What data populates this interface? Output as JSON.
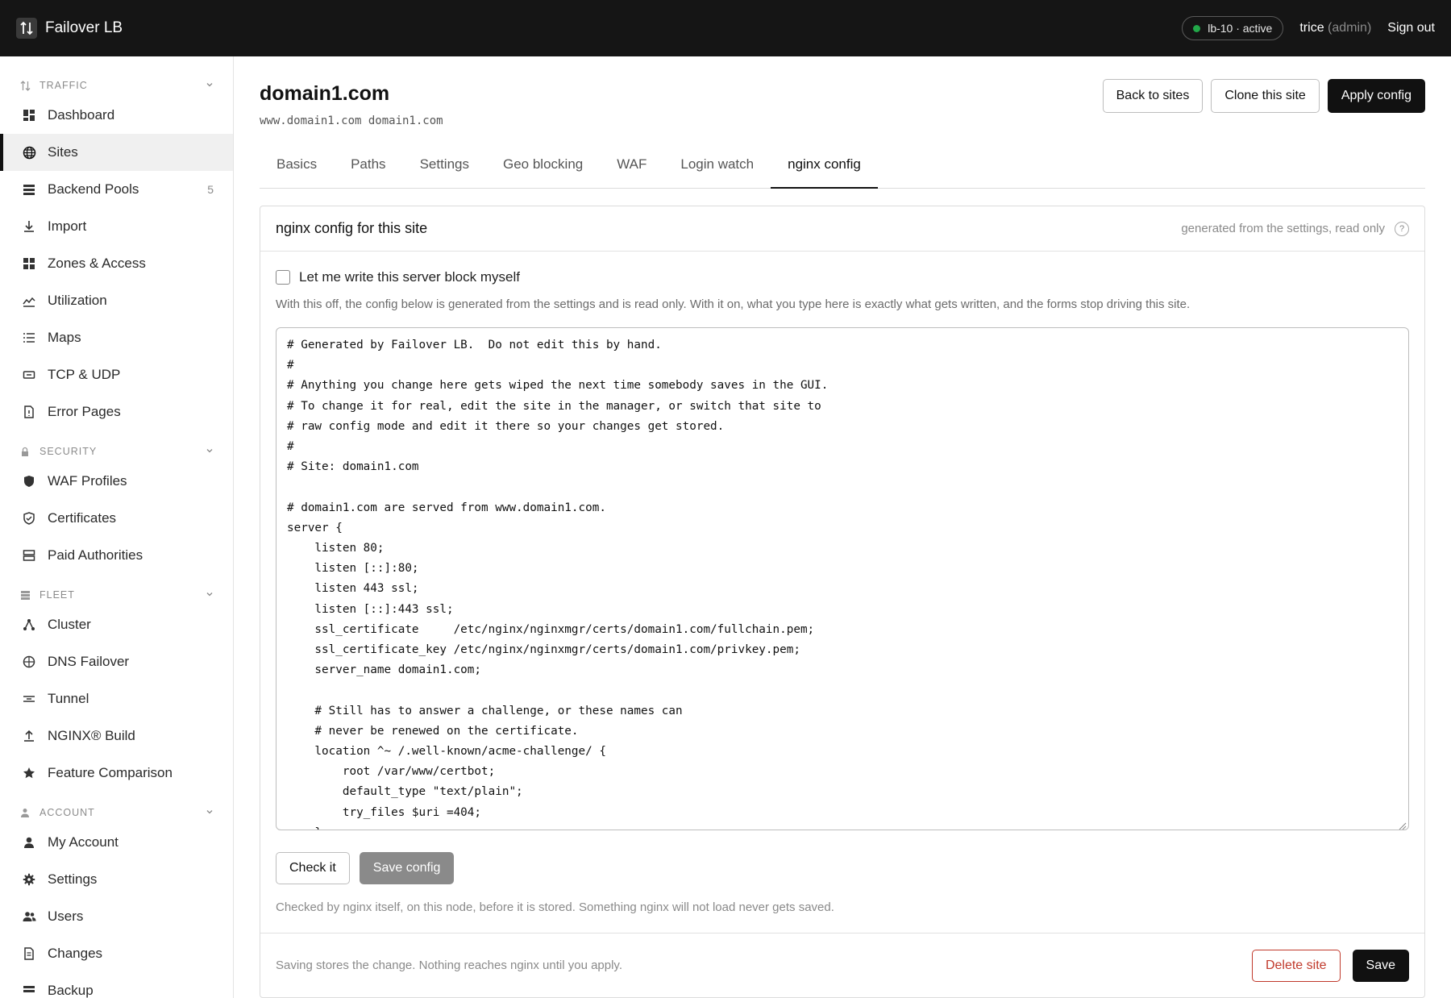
{
  "app": {
    "title": "Failover LB",
    "status": "lb-10 · active",
    "status_color": "#22a849",
    "user_name": "trice",
    "user_role": "(admin)",
    "sign_out": "Sign out"
  },
  "sidebar": {
    "sections": [
      {
        "title": "TRAFFIC",
        "icon": "arrows-updown-icon",
        "items": [
          {
            "label": "Dashboard",
            "icon": "dashboard-icon"
          },
          {
            "label": "Sites",
            "icon": "globe-icon",
            "active": true
          },
          {
            "label": "Backend Pools",
            "icon": "pools-icon",
            "count": "5"
          },
          {
            "label": "Import",
            "icon": "import-icon"
          },
          {
            "label": "Zones & Access",
            "icon": "zones-icon"
          },
          {
            "label": "Utilization",
            "icon": "chart-icon"
          },
          {
            "label": "Maps",
            "icon": "list-icon"
          },
          {
            "label": "TCP & UDP",
            "icon": "tcp-icon"
          },
          {
            "label": "Error Pages",
            "icon": "file-icon"
          }
        ]
      },
      {
        "title": "SECURITY",
        "icon": "lock-icon",
        "items": [
          {
            "label": "WAF Profiles",
            "icon": "shield-icon"
          },
          {
            "label": "Certificates",
            "icon": "certificate-icon"
          },
          {
            "label": "Paid Authorities",
            "icon": "server-icon"
          }
        ]
      },
      {
        "title": "FLEET",
        "icon": "fleet-icon",
        "items": [
          {
            "label": "Cluster",
            "icon": "cluster-icon"
          },
          {
            "label": "DNS Failover",
            "icon": "dns-icon"
          },
          {
            "label": "Tunnel",
            "icon": "tunnel-icon"
          },
          {
            "label": "NGINX® Build",
            "icon": "upload-icon"
          },
          {
            "label": "Feature Comparison",
            "icon": "star-icon"
          }
        ]
      },
      {
        "title": "ACCOUNT",
        "icon": "user-small-icon",
        "items": [
          {
            "label": "My Account",
            "icon": "user-icon"
          },
          {
            "label": "Settings",
            "icon": "gear-icon"
          },
          {
            "label": "Users",
            "icon": "users-icon"
          },
          {
            "label": "Changes",
            "icon": "changes-icon"
          },
          {
            "label": "Backup",
            "icon": "backup-icon"
          }
        ]
      }
    ]
  },
  "page": {
    "title": "domain1.com",
    "subtitle": "www.domain1.com domain1.com",
    "back_label": "Back to sites",
    "clone_label": "Clone this site",
    "apply_label": "Apply config"
  },
  "tabs": [
    {
      "label": "Basics"
    },
    {
      "label": "Paths"
    },
    {
      "label": "Settings"
    },
    {
      "label": "Geo blocking"
    },
    {
      "label": "WAF"
    },
    {
      "label": "Login watch"
    },
    {
      "label": "nginx config",
      "active": true
    }
  ],
  "config": {
    "title": "nginx config for this site",
    "note": "generated from the settings, read only",
    "help": "?",
    "checkbox_label": "Let me write this server block myself",
    "help_text": "With this off, the config below is generated from the settings and is read only. With it on, what you type here is exactly what gets written, and the forms stop driving this site.",
    "code": "# Generated by Failover LB.  Do not edit this by hand.\n#\n# Anything you change here gets wiped the next time somebody saves in the GUI.\n# To change it for real, edit the site in the manager, or switch that site to\n# raw config mode and edit it there so your changes get stored.\n#\n# Site: domain1.com\n\n# domain1.com are served from www.domain1.com.\nserver {\n    listen 80;\n    listen [::]:80;\n    listen 443 ssl;\n    listen [::]:443 ssl;\n    ssl_certificate     /etc/nginx/nginxmgr/certs/domain1.com/fullchain.pem;\n    ssl_certificate_key /etc/nginx/nginxmgr/certs/domain1.com/privkey.pem;\n    server_name domain1.com;\n\n    # Still has to answer a challenge, or these names can\n    # never be renewed on the certificate.\n    location ^~ /.well-known/acme-challenge/ {\n        root /var/www/certbot;\n        default_type \"text/plain\";\n        try_files $uri =404;\n    }",
    "check_label": "Check it",
    "save_config_label": "Save config",
    "check_note": "Checked by nginx itself, on this node, before it is stored. Something nginx will not load never gets saved."
  },
  "footer": {
    "text": "Saving stores the change. Nothing reaches nginx until you apply.",
    "delete_label": "Delete site",
    "save_label": "Save"
  }
}
